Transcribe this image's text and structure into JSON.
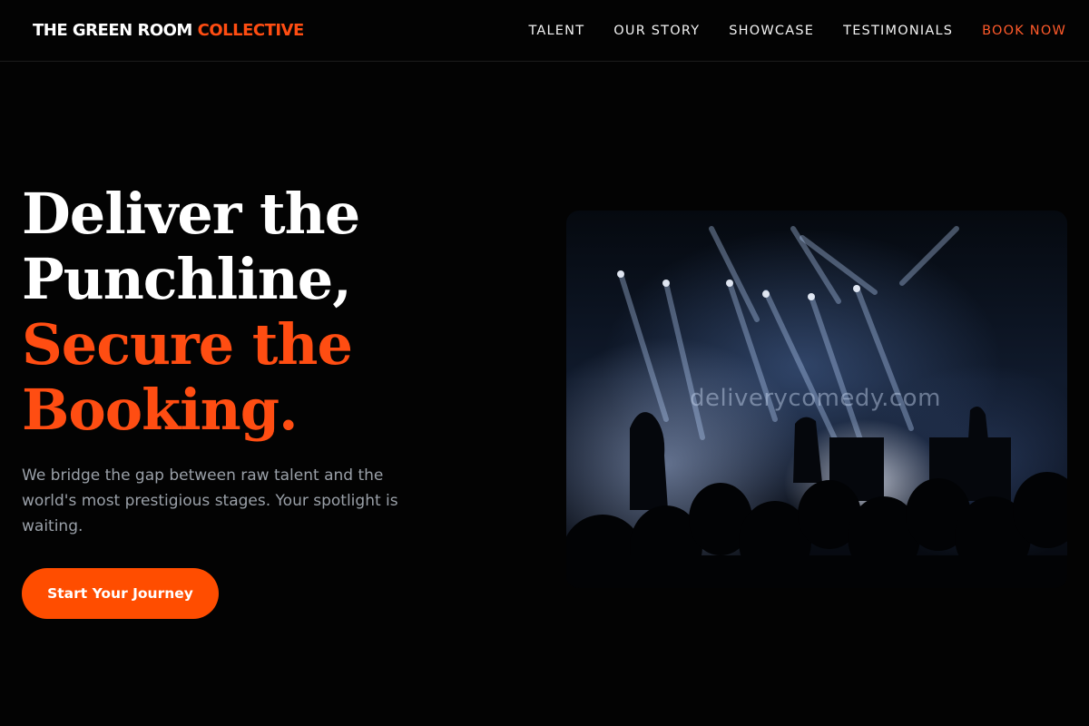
{
  "header": {
    "logo_main": "THE GREEN ROOM",
    "logo_accent": "COLLECTIVE",
    "nav": [
      {
        "label": "TALENT"
      },
      {
        "label": "OUR STORY"
      },
      {
        "label": "SHOWCASE"
      },
      {
        "label": "TESTIMONIALS"
      },
      {
        "label": "BOOK NOW"
      }
    ]
  },
  "hero": {
    "title_line1": "Deliver the",
    "title_line2": "Punchline,",
    "title_line3": "Secure the",
    "title_line4": "Booking.",
    "subtitle": "We bridge the gap between raw talent and the world's most prestigious stages. Your spotlight is waiting.",
    "cta_label": "Start Your Journey",
    "image_watermark": "deliverycomedy.com"
  },
  "colors": {
    "accent": "#ff4d12",
    "background": "#030303",
    "muted_text": "#9aa0a8"
  }
}
